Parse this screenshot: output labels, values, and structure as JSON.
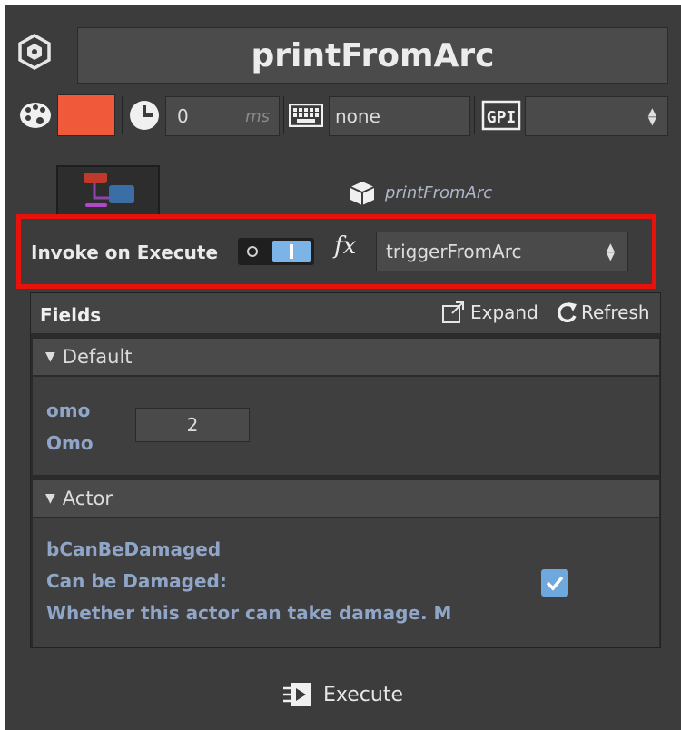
{
  "node": {
    "title": "printFromArc",
    "subtitle": "printFromArc"
  },
  "toolbar": {
    "color": "#f05a3a",
    "delay_value": "0",
    "delay_unit": "ms",
    "keyboard_value": "none",
    "gpi_value": ""
  },
  "invoke": {
    "label": "Invoke on Execute",
    "toggle_state": "on",
    "fx_label": "fx",
    "function_value": "triggerFromArc"
  },
  "fields": {
    "title": "Fields",
    "expand_label": "Expand",
    "refresh_label": "Refresh",
    "sections": [
      {
        "title": "Default",
        "name": "omo",
        "label": "Omo",
        "value": "2"
      },
      {
        "title": "Actor",
        "name": "bCanBeDamaged",
        "label": "Can be Damaged:",
        "description": "Whether this actor can take damage. M",
        "checked": true
      }
    ]
  },
  "execute": {
    "label": "Execute"
  }
}
